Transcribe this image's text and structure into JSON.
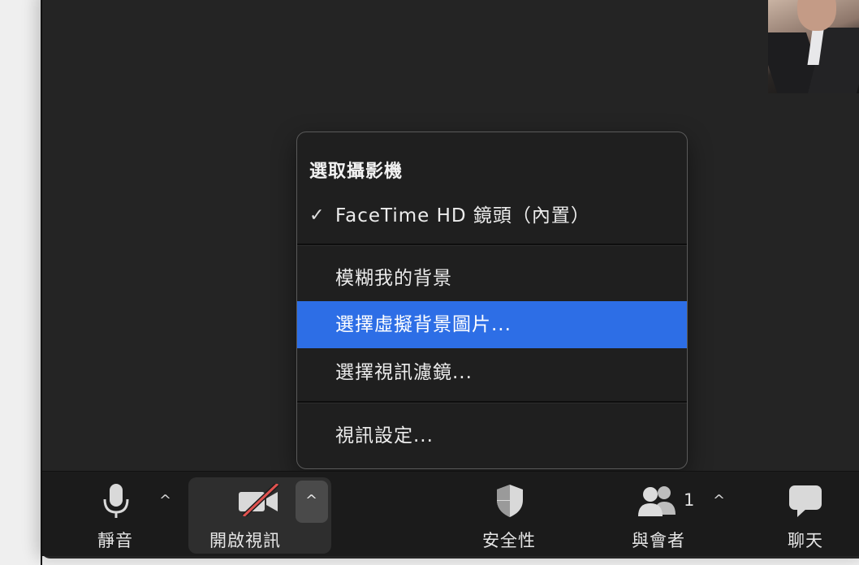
{
  "menu": {
    "header": "選取攝影機",
    "camera_item": {
      "label": "FaceTime HD 鏡頭（內置）",
      "checked": true,
      "check_glyph": "✓"
    },
    "blur_item": "模糊我的背景",
    "virtual_bg_item": "選擇虛擬背景圖片...",
    "filter_item": "選擇視訊濾鏡...",
    "settings_item": "視訊設定...",
    "highlight_color": "#2d6ee6"
  },
  "toolbar": {
    "mute_label": "靜音",
    "video_label": "開啟視訊",
    "security_label": "安全性",
    "participants_label": "與會者",
    "participants_count": "1",
    "chat_label": "聊天",
    "caret_glyph": "^",
    "video_off_slash_color": "#e0524f"
  },
  "icons": {
    "mute": "microphone-icon",
    "video": "video-off-icon",
    "security": "shield-icon",
    "participants": "people-icon",
    "chat": "chat-bubble-icon"
  }
}
